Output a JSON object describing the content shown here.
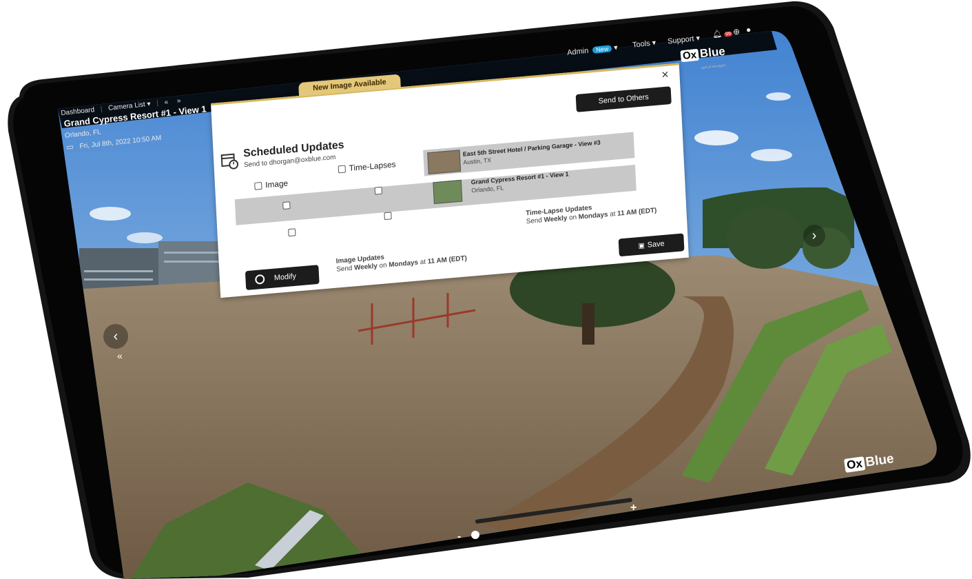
{
  "app": {
    "brand": "OxBlue",
    "brand_sub": "part of Hexagon"
  },
  "topnav": {
    "admin": "Admin",
    "new_badge": "New",
    "tools": "Tools",
    "support": "Support",
    "notification_count": "99"
  },
  "subnav": {
    "dashboard": "Dashboard",
    "camera_list": "Camera List",
    "prev": "«",
    "next": "»"
  },
  "camera": {
    "title": "Grand Cypress Resort #1 - View 1",
    "location": "Orlando, FL",
    "datetime": "Fri, Jul 8th, 2022 10:50 AM"
  },
  "modal": {
    "banner": "New Image Available",
    "title": "Scheduled Updates",
    "send_to": "Send to dhorgan@oxblue.com",
    "send_to_others": "Send to Others",
    "col_image": "Image",
    "col_timelapses": "Time-Lapses",
    "rows": [
      {
        "name": "East 5th Street Hotel / Parking Garage - View #3",
        "location": "Austin, TX"
      },
      {
        "name": "Grand Cypress Resort #1 - View 1",
        "location": "Orlando, FL"
      }
    ],
    "modify": "Modify",
    "image_updates_label": "Image Updates",
    "image_updates_send": "Send",
    "image_updates_freq": "Weekly",
    "image_updates_on": "on",
    "image_updates_day": "Mondays",
    "image_updates_at": "at",
    "image_updates_time": "11 AM (EDT)",
    "timelapse_updates_label": "Time-Lapse Updates",
    "timelapse_updates_send": "Send",
    "timelapse_updates_freq": "Weekly",
    "timelapse_updates_on": "on",
    "timelapse_updates_day": "Mondays",
    "timelapse_updates_at": "at",
    "timelapse_updates_time": "11 AM (EDT)",
    "save": "Save",
    "close": "×"
  },
  "zoom": {
    "minus": "-",
    "plus": "+"
  },
  "watermark": "OxBlue"
}
